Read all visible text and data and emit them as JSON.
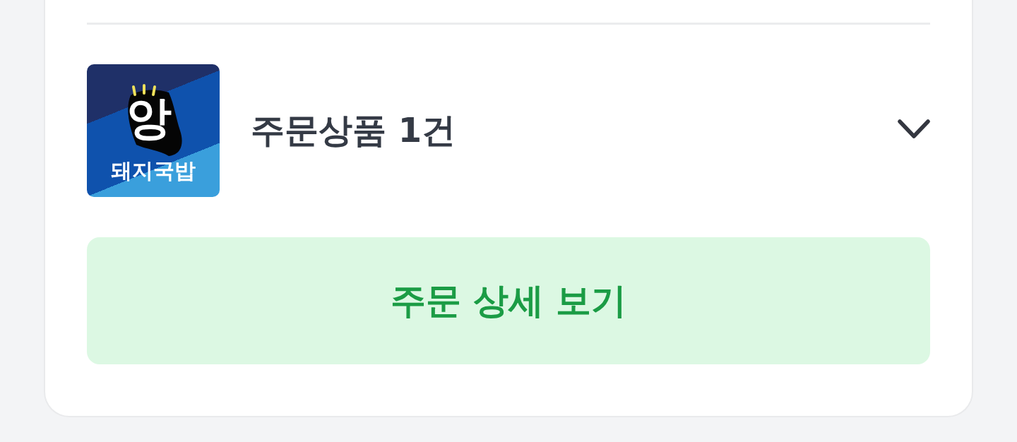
{
  "order_items": {
    "thumbnail": {
      "mark": "앙",
      "name": "돼지국밥"
    },
    "title": "주문상품 1건",
    "expanded": false
  },
  "detail_button": {
    "label": "주문 상세 보기"
  }
}
